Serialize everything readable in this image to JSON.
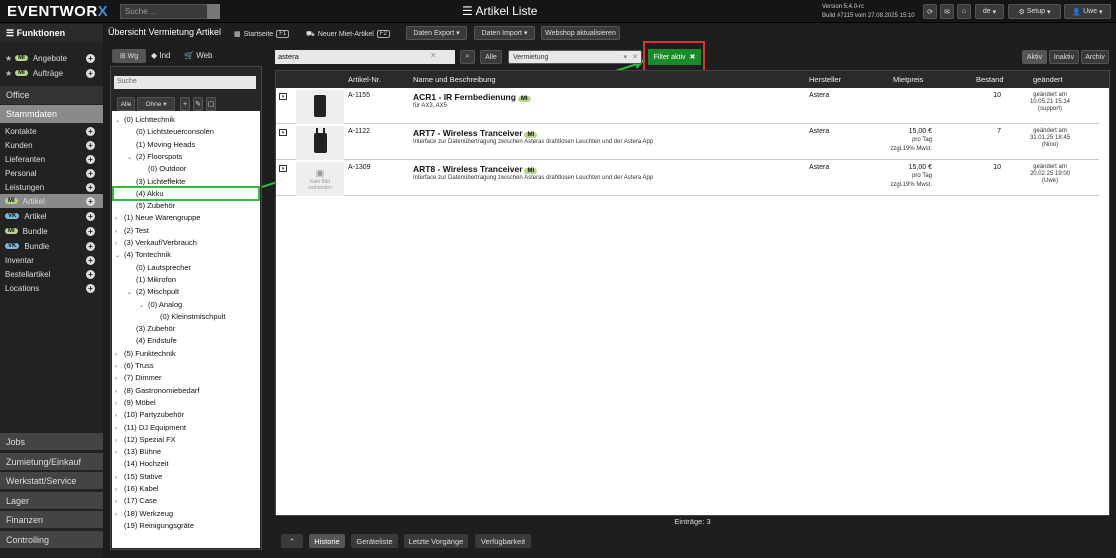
{
  "app": {
    "logo_main": "EVENTWOR",
    "logo_x": "X",
    "window_title": "Artikel Liste",
    "search_placeholder": "Suche ...",
    "version_line1": "Version 5.4.0-rc",
    "version_line2": "Build #7115 vom 27.08.2025 15:10",
    "lang": "de",
    "setup_label": "Setup",
    "user_label": "Uwe"
  },
  "sidebar": {
    "header": "Funktionen",
    "quick": [
      {
        "badge": "MI",
        "label": "Angebote"
      },
      {
        "badge": "MI",
        "label": "Aufträge"
      }
    ],
    "office": "Office",
    "stammdaten": "Stammdaten",
    "items": [
      {
        "label": "Kontakte"
      },
      {
        "label": "Kunden"
      },
      {
        "label": "Lieferanten"
      },
      {
        "label": "Personal"
      },
      {
        "label": "Leistungen"
      }
    ],
    "artikel_items": [
      {
        "badge": "MI",
        "label": "Artikel",
        "selected": true
      },
      {
        "badge": "VK",
        "label": "Artikel"
      },
      {
        "badge": "MI",
        "label": "Bundle"
      },
      {
        "badge": "VK",
        "label": "Bundle"
      }
    ],
    "more_items": [
      {
        "label": "Inventar"
      },
      {
        "label": "Bestellartikel"
      },
      {
        "label": "Locations"
      }
    ],
    "sections": [
      "Jobs",
      "Zumietung/Einkauf",
      "Werkstatt/Service",
      "Lager",
      "Finanzen",
      "Controlling"
    ]
  },
  "toolbar": {
    "page_title": "Übersicht Vermietung Artikel",
    "start_label": "Startseite",
    "start_key": "F1",
    "new_label": "Neuer Miet-Artikel",
    "new_key": "F2",
    "export_label": "Daten Export",
    "import_label": "Daten Import",
    "webshop_label": "Webshop aktualisieren"
  },
  "tree": {
    "tabs": [
      "Wg",
      "Ind",
      "Web"
    ],
    "search_placeholder": "Suche",
    "btn_all": "Alle",
    "btn_none": "Ohne",
    "nodes": [
      {
        "label": "(0) Lichttechnik",
        "depth": 0,
        "tog": "v"
      },
      {
        "label": "(0) Lichtsteuerconsolen",
        "depth": 1,
        "tog": ""
      },
      {
        "label": "(1) Moving Heads",
        "depth": 1,
        "tog": ""
      },
      {
        "label": "(2) Floorspots",
        "depth": 1,
        "tog": "v"
      },
      {
        "label": "(0) Outdoor",
        "depth": 2,
        "tog": ""
      },
      {
        "label": "(3) Lichteffekte",
        "depth": 1,
        "tog": ""
      },
      {
        "label": "(4) Akku",
        "depth": 1,
        "tog": ""
      },
      {
        "label": "(5) Zubehör",
        "depth": 1,
        "tog": ""
      },
      {
        "label": "(1) Neue Warengruppe",
        "depth": 0,
        "tog": ">"
      },
      {
        "label": "(2) Test",
        "depth": 0,
        "tog": ">"
      },
      {
        "label": "(3) Verkauf/Verbrauch",
        "depth": 0,
        "tog": ">"
      },
      {
        "label": "(4) Tontechnik",
        "depth": 0,
        "tog": "v"
      },
      {
        "label": "(0) Lautsprecher",
        "depth": 1,
        "tog": ""
      },
      {
        "label": "(1) Mikrofon",
        "depth": 1,
        "tog": ""
      },
      {
        "label": "(2) Mischpult",
        "depth": 1,
        "tog": "v"
      },
      {
        "label": "(0) Analog",
        "depth": 2,
        "tog": "v"
      },
      {
        "label": "(0) Kleinstmischpult",
        "depth": 3,
        "tog": ""
      },
      {
        "label": "(3) Zubehör",
        "depth": 1,
        "tog": ""
      },
      {
        "label": "(4) Endstufe",
        "depth": 1,
        "tog": ""
      },
      {
        "label": "(5) Funktechnik",
        "depth": 0,
        "tog": ">"
      },
      {
        "label": "(6) Truss",
        "depth": 0,
        "tog": ">"
      },
      {
        "label": "(7) Dimmer",
        "depth": 0,
        "tog": ">"
      },
      {
        "label": "(8) Gastronomiebedarf",
        "depth": 0,
        "tog": ">"
      },
      {
        "label": "(9) Möbel",
        "depth": 0,
        "tog": ">"
      },
      {
        "label": "(10) Partyzubehör",
        "depth": 0,
        "tog": ">"
      },
      {
        "label": "(11) DJ Equipment",
        "depth": 0,
        "tog": ">"
      },
      {
        "label": "(12) Spezial FX",
        "depth": 0,
        "tog": ">"
      },
      {
        "label": "(13) Bühne",
        "depth": 0,
        "tog": ">"
      },
      {
        "label": "(14) Hochzeit",
        "depth": 0,
        "tog": ""
      },
      {
        "label": "(15) Stative",
        "depth": 0,
        "tog": ">"
      },
      {
        "label": "(16) Kabel",
        "depth": 0,
        "tog": ">"
      },
      {
        "label": "(17) Case",
        "depth": 0,
        "tog": ">"
      },
      {
        "label": "(18) Werkzeug",
        "depth": 0,
        "tog": ">"
      },
      {
        "label": "(19) Reinigungsgräte",
        "depth": 0,
        "tog": ""
      }
    ]
  },
  "filters": {
    "search_value": "astera",
    "all_label": "Alle",
    "type_value": "Vermietung",
    "filter_label": "Filter aktiv",
    "status_tabs": [
      "Aktiv",
      "Inaktiv",
      "Archiv"
    ]
  },
  "table": {
    "headers": {
      "artnr": "Artikel-Nr.",
      "name": "Name und Beschreibung",
      "hersteller": "Hersteller",
      "preis": "Mietpreis",
      "bestand": "Bestand",
      "geaendert": "geändert"
    },
    "rows": [
      {
        "artnr": "A-1155",
        "name": "ACR1 - IR Fernbedienung",
        "badge": "MI",
        "desc": "für AX3, AX5",
        "hersteller": "Astera",
        "preis": "",
        "preis_unit": "",
        "preis_tax": "",
        "bestand": "10",
        "ch1": "geändert am",
        "ch2": "10.05.21 15:14",
        "ch3": "(support)",
        "thumb": "remote"
      },
      {
        "artnr": "A-1122",
        "name": "ART7 - Wireless Tranceiver",
        "badge": "MI",
        "desc": "Interface zur Datenübertragung zwischen Asteras drahtlosen Leuchten und der Astera App",
        "hersteller": "Astera",
        "preis": "15,00 €",
        "preis_unit": "pro Tag",
        "preis_tax": "zzgl.19% Mwst.",
        "bestand": "7",
        "ch1": "geändert am",
        "ch2": "31.01.25 18:45",
        "ch3": "(Nino)",
        "thumb": "transceiver"
      },
      {
        "artnr": "A-1309",
        "name": "ART8 - Wireless Tranceiver",
        "badge": "MI",
        "desc": "Interface zur Datenübertragung zwischen Asteras drahtlosen Leuchten und der Astera App",
        "hersteller": "Astera",
        "preis": "15,00 €",
        "preis_unit": "pro Tag",
        "preis_tax": "zzgl.19% Mwst.",
        "bestand": "10",
        "ch1": "geändert am",
        "ch2": "20.02.25 19:00",
        "ch3": "(Uwe)",
        "thumb": "none",
        "thumb_text1": "Kein Bild",
        "thumb_text2": "vorhanden"
      }
    ],
    "count_label": "Einträge: 3"
  },
  "bottom_tabs": [
    "Historie",
    "Geräteliste",
    "Letzte Vorgänge",
    "Verfügbarkeit"
  ],
  "colors": {
    "accent_green": "#1a8b2a",
    "highlight_red": "#e03030",
    "highlight_green": "#2fbd3a",
    "badge_mi": "#b9d48a",
    "badge_vk": "#7ab8d8"
  }
}
